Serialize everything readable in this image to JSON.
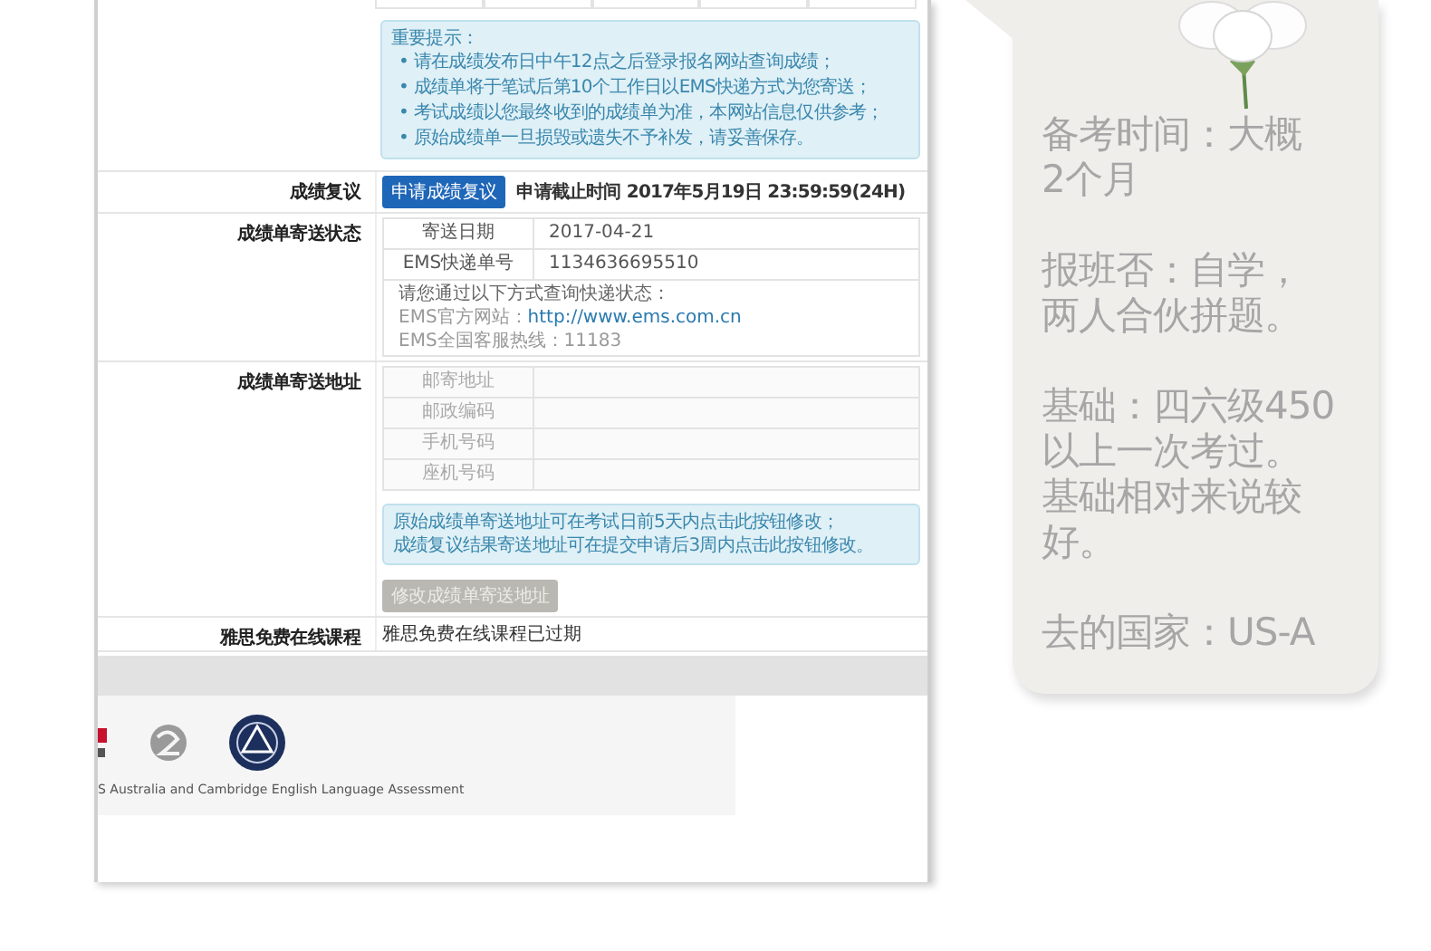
{
  "score_page": {
    "notice": {
      "title": "重要提示：",
      "items": [
        {
          "marker": "•",
          "text": "请在成绩发布日中午12点之后登录报名网站查询成绩；"
        },
        {
          "marker": "•",
          "text": "成绩单将于笔试后第10个工作日以EMS快递方式为您寄送；"
        },
        {
          "marker": "•",
          "text": "考试成绩以您最终收到的成绩单为准，本网站信息仅供参考；"
        },
        {
          "marker": "•",
          "text": "原始成绩单一旦损毁或遗失不予补发，请妥善保存。"
        }
      ]
    },
    "rows": [
      {
        "kind": "review",
        "label": "成绩复议",
        "button": "申请成绩复议",
        "deadline": "申请截止时间 2017年5月19日 23:59:59(24H)"
      },
      {
        "kind": "shipping",
        "label": "成绩单寄送状态",
        "fields": [
          {
            "label": "寄送日期",
            "value": "2017-04-21"
          },
          {
            "label": "EMS快递单号",
            "value": "1134636695510"
          }
        ],
        "query": {
          "intro": "请您通过以下方式查询快递状态：",
          "website_label": "EMS官方网站：",
          "website": "http://www.ems.com.cn",
          "hotline": "EMS全国客服热线：11183"
        }
      },
      {
        "kind": "address",
        "label": "成绩单寄送地址",
        "fields": [
          "邮寄地址",
          "邮政编码",
          "手机号码",
          "座机号码"
        ],
        "notice": [
          "原始成绩单寄送地址可在考试日前5天内点击此按钮修改；",
          "成绩复议结果寄送地址可在提交申请后3周内点击此按钮修改。"
        ],
        "button": {
          "label": "修改成绩单寄送地址",
          "disabled": true
        }
      },
      {
        "kind": "course",
        "label": "雅思免费在线课程",
        "value": "雅思免费在线课程已过期"
      }
    ],
    "footer": {
      "caption": "S Australia and Cambridge English Language Assessment"
    }
  },
  "note_card": {
    "paragraphs": [
      [
        "备考时间：大概",
        "2个月"
      ],
      [
        "报班否：自学，",
        "两人合伙拼题。"
      ],
      [
        "基础：四六级450",
        "以上一次考过。",
        "基础相对来说较",
        "好。"
      ],
      [
        "去的国家：US-A"
      ]
    ]
  }
}
